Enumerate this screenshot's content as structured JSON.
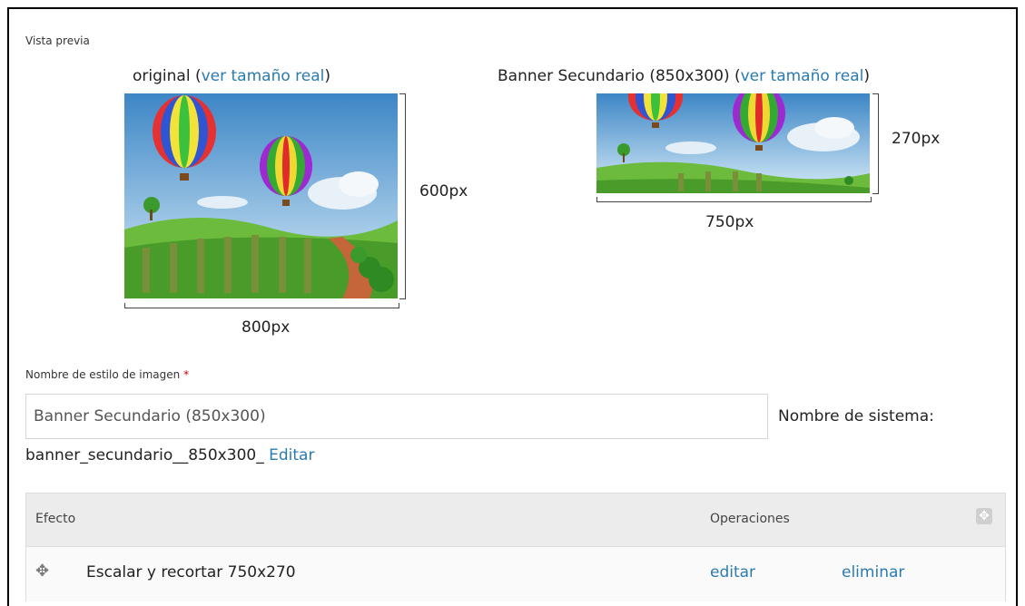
{
  "preview": {
    "section_label": "Vista previa",
    "original": {
      "caption": "original",
      "link_text": "ver tamaño real",
      "paren_open": " (",
      "paren_close": ")",
      "height_label": "600px",
      "width_label": "800px"
    },
    "derivative": {
      "caption": "Banner Secundario (850x300)",
      "link_text": "ver tamaño real",
      "paren_open": " (",
      "paren_close": ")",
      "height_label": "270px",
      "width_label": "750px"
    }
  },
  "form": {
    "name_label": "Nombre de estilo de imagen",
    "required_mark": "*",
    "name_value": "Banner Secundario (850x300)",
    "system_name_label": "Nombre de sistema:",
    "system_name_value": "banner_secundario__850x300_",
    "edit_link": "Editar"
  },
  "effects_table": {
    "col_effect": "Efecto",
    "col_operations": "Operaciones",
    "rows": [
      {
        "effect": "Escalar y recortar 750x270",
        "edit": "editar",
        "delete": "eliminar"
      }
    ]
  },
  "colors": {
    "link": "#2a7bb0",
    "required": "#cc0000"
  }
}
